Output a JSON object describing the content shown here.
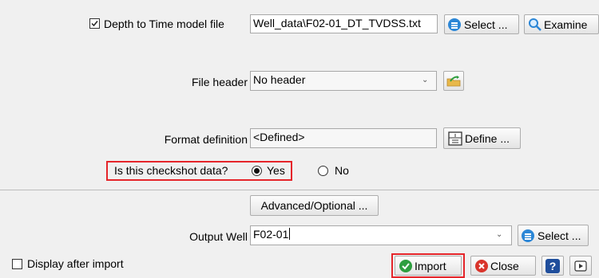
{
  "depth_time": {
    "checkbox_checked": true,
    "label": "Depth to Time model file",
    "value": "Well_data\\F02-01_DT_TVDSS.txt",
    "select_label": "Select ...",
    "examine_label": "Examine"
  },
  "file_header": {
    "label": "File header",
    "value": "No header"
  },
  "format_definition": {
    "label": "Format definition",
    "value": "<Defined>",
    "define_label": "Define ..."
  },
  "checkshot": {
    "question": "Is this checkshot data?",
    "yes_label": "Yes",
    "no_label": "No",
    "selected": "Yes"
  },
  "advanced_label": "Advanced/Optional ...",
  "output_well": {
    "label": "Output Well",
    "value": "F02-01",
    "select_label": "Select ..."
  },
  "display_after_import": {
    "label": "Display after import",
    "checked": false
  },
  "footer": {
    "import_label": "Import",
    "close_label": "Close",
    "help_symbol": "?",
    "colors": {
      "highlight": "#e5252a",
      "import_green": "#2e9e3f",
      "close_red": "#d9342b",
      "help_blue": "#1f4e9c",
      "accent_blue": "#2b86d6"
    }
  }
}
